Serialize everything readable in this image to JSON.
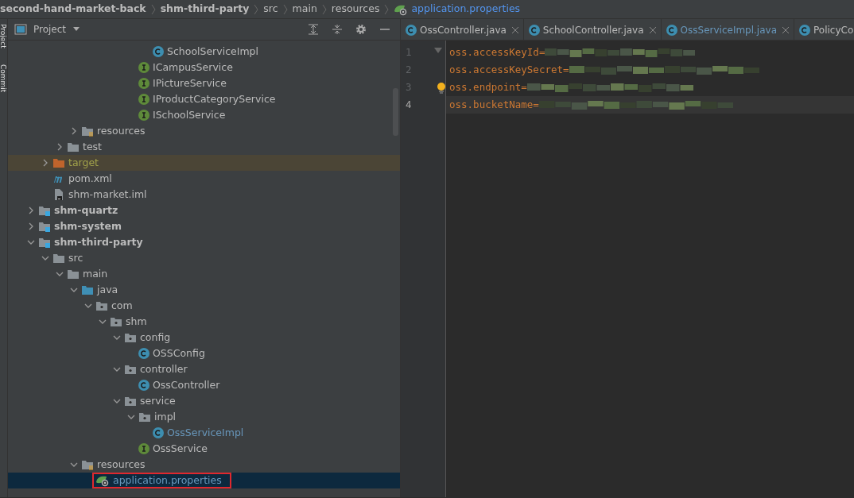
{
  "breadcrumb": [
    {
      "label": "second-hand-market-back",
      "bold": true,
      "kind": "project"
    },
    {
      "label": "shm-third-party",
      "bold": true,
      "kind": "module"
    },
    {
      "label": "src",
      "bold": false,
      "kind": "folder"
    },
    {
      "label": "main",
      "bold": false,
      "kind": "folder"
    },
    {
      "label": "resources",
      "bold": false,
      "kind": "folder"
    },
    {
      "label": "application.properties",
      "bold": false,
      "kind": "file"
    }
  ],
  "side_strip": [
    {
      "label": "Project"
    },
    {
      "label": "Commit"
    }
  ],
  "project_panel": {
    "title": "Project"
  },
  "tree": [
    {
      "children": [
        {
          "children": [
            {
              "children": [
                {
                  "children": [
                    {
                      "children": [
                        {
                          "children": [
                            {
                              "children": [
                                {
                                  "children": [
                                    {
                                      "label": "SchoolServiceImpl",
                                      "kind": "class",
                                      "selected": false
                                    }
                                  ]
                                },
                                {
                                  "label": "ICampusService",
                                  "kind": "interface",
                                  "selected": false
                                },
                                {
                                  "label": "IPictureService",
                                  "kind": "interface",
                                  "selected": false
                                },
                                {
                                  "label": "IProductCategoryService",
                                  "kind": "interface",
                                  "selected": false
                                },
                                {
                                  "label": "ISchoolService",
                                  "kind": "interface",
                                  "selected": false
                                }
                              ]
                            }
                          ]
                        }
                      ]
                    }
                  ]
                },
                {
                  "label": "resources",
                  "kind": "resources",
                  "expanded": false,
                  "selected": false
                }
              ]
            },
            {
              "label": "test",
              "kind": "folder",
              "expanded": false,
              "selected": false
            }
          ]
        },
        {
          "label": "target",
          "kind": "excluded",
          "expanded": false,
          "selected": false
        },
        {
          "label": "pom.xml",
          "kind": "maven",
          "selected": false
        },
        {
          "label": "shm-market.iml",
          "kind": "iml",
          "selected": false
        }
      ]
    },
    {
      "label": "shm-quartz",
      "kind": "module",
      "expanded": false,
      "selected": false
    },
    {
      "label": "shm-system",
      "kind": "module",
      "expanded": false,
      "selected": false
    },
    {
      "label": "shm-third-party",
      "kind": "module",
      "expanded": true,
      "selected": false,
      "children": [
        {
          "label": "src",
          "kind": "folder",
          "expanded": true,
          "selected": false,
          "children": [
            {
              "label": "main",
              "kind": "folder",
              "expanded": true,
              "selected": false,
              "children": [
                {
                  "label": "java",
                  "kind": "source",
                  "expanded": true,
                  "selected": false,
                  "children": [
                    {
                      "label": "com",
                      "kind": "package",
                      "expanded": true,
                      "selected": false,
                      "children": [
                        {
                          "label": "shm",
                          "kind": "package",
                          "expanded": true,
                          "selected": false,
                          "children": [
                            {
                              "label": "config",
                              "kind": "package",
                              "expanded": true,
                              "selected": false,
                              "children": [
                                {
                                  "label": "OSSConfig",
                                  "kind": "class",
                                  "selected": false
                                }
                              ]
                            },
                            {
                              "label": "controller",
                              "kind": "package",
                              "expanded": true,
                              "selected": false,
                              "children": [
                                {
                                  "label": "OssController",
                                  "kind": "class",
                                  "selected": false
                                }
                              ]
                            },
                            {
                              "label": "service",
                              "kind": "package",
                              "expanded": true,
                              "selected": false,
                              "children": [
                                {
                                  "label": "impl",
                                  "kind": "package",
                                  "expanded": true,
                                  "selected": false,
                                  "children": [
                                    {
                                      "label": "OssServiceImpl",
                                      "kind": "class",
                                      "modified": true,
                                      "selected": false
                                    }
                                  ]
                                },
                                {
                                  "label": "OssService",
                                  "kind": "interface",
                                  "selected": false
                                }
                              ]
                            }
                          ]
                        }
                      ]
                    }
                  ]
                },
                {
                  "label": "resources",
                  "kind": "resources",
                  "expanded": true,
                  "selected": false,
                  "children": [
                    {
                      "label": "application.properties",
                      "kind": "properties",
                      "selected": true,
                      "highlighted": true
                    }
                  ]
                }
              ]
            }
          ]
        }
      ]
    }
  ],
  "editor_tabs": [
    {
      "label": "OssController.java",
      "modified": false,
      "selected": false,
      "closable": true
    },
    {
      "label": "SchoolController.java",
      "modified": false,
      "selected": false,
      "closable": true
    },
    {
      "label": "OssServiceImpl.java",
      "modified": true,
      "selected": false,
      "closable": true
    },
    {
      "label": "PolicyCo",
      "modified": false,
      "selected": false,
      "closable": false
    }
  ],
  "code_lines": [
    {
      "number": "1",
      "text": "oss.accessKeyId=",
      "current": false,
      "fold": true
    },
    {
      "number": "2",
      "text": "oss.accessKeySecret=",
      "current": false
    },
    {
      "number": "3",
      "text": "oss.endpoint=",
      "current": false,
      "bulb": true
    },
    {
      "number": "4",
      "text": "oss.bucketName=",
      "current": true
    }
  ]
}
